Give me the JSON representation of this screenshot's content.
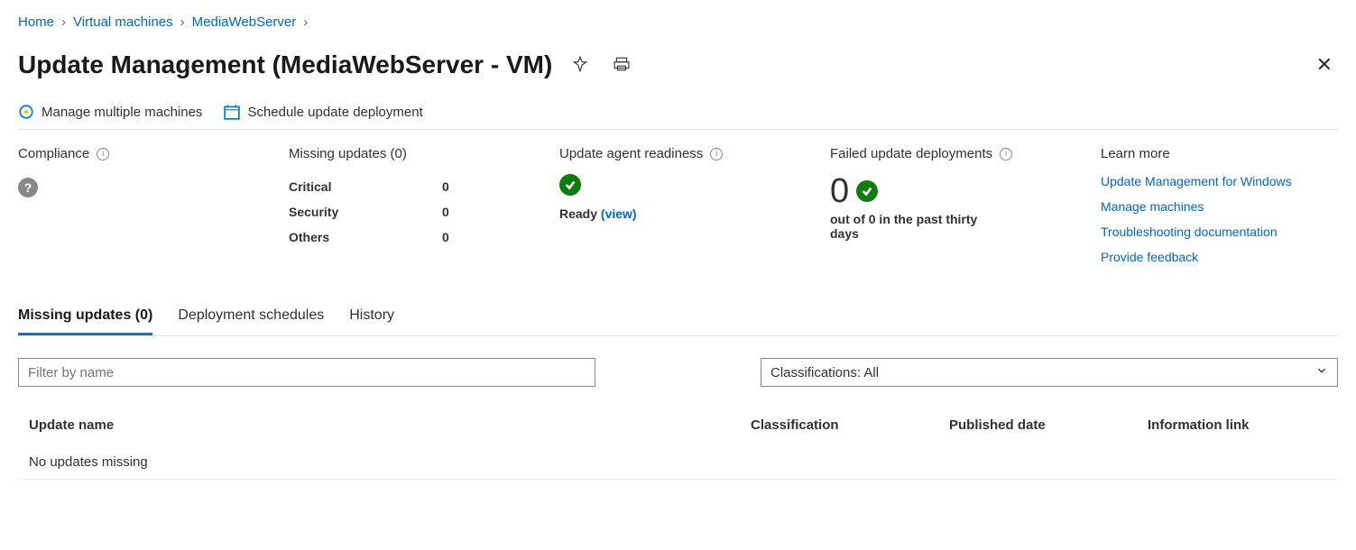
{
  "breadcrumbs": {
    "b0": "Home",
    "b1": "Virtual machines",
    "b2": "MediaWebServer"
  },
  "title": "Update Management (MediaWebServer - VM)",
  "toolbar": {
    "manage": "Manage multiple machines",
    "schedule": "Schedule update deployment"
  },
  "summary": {
    "compliance": {
      "head": "Compliance"
    },
    "missing": {
      "head": "Missing updates (0)",
      "rows": [
        {
          "label": "Critical",
          "value": "0"
        },
        {
          "label": "Security",
          "value": "0"
        },
        {
          "label": "Others",
          "value": "0"
        }
      ]
    },
    "agent": {
      "head": "Update agent readiness",
      "status": "Ready",
      "view": "(view)"
    },
    "failed": {
      "head": "Failed update deployments",
      "big": "0",
      "sub": "out of 0 in the past thirty days"
    },
    "learn": {
      "head": "Learn more",
      "links": {
        "l0": "Update Management for Windows",
        "l1": "Manage machines",
        "l2": "Troubleshooting documentation",
        "l3": "Provide feedback"
      }
    }
  },
  "tabs": {
    "t0": "Missing updates (0)",
    "t1": "Deployment schedules",
    "t2": "History"
  },
  "filter": {
    "placeholder": "Filter by name"
  },
  "classdd": "Classifications: All",
  "table": {
    "h0": "Update name",
    "h1": "Classification",
    "h2": "Published date",
    "h3": "Information link",
    "empty": "No updates missing"
  }
}
